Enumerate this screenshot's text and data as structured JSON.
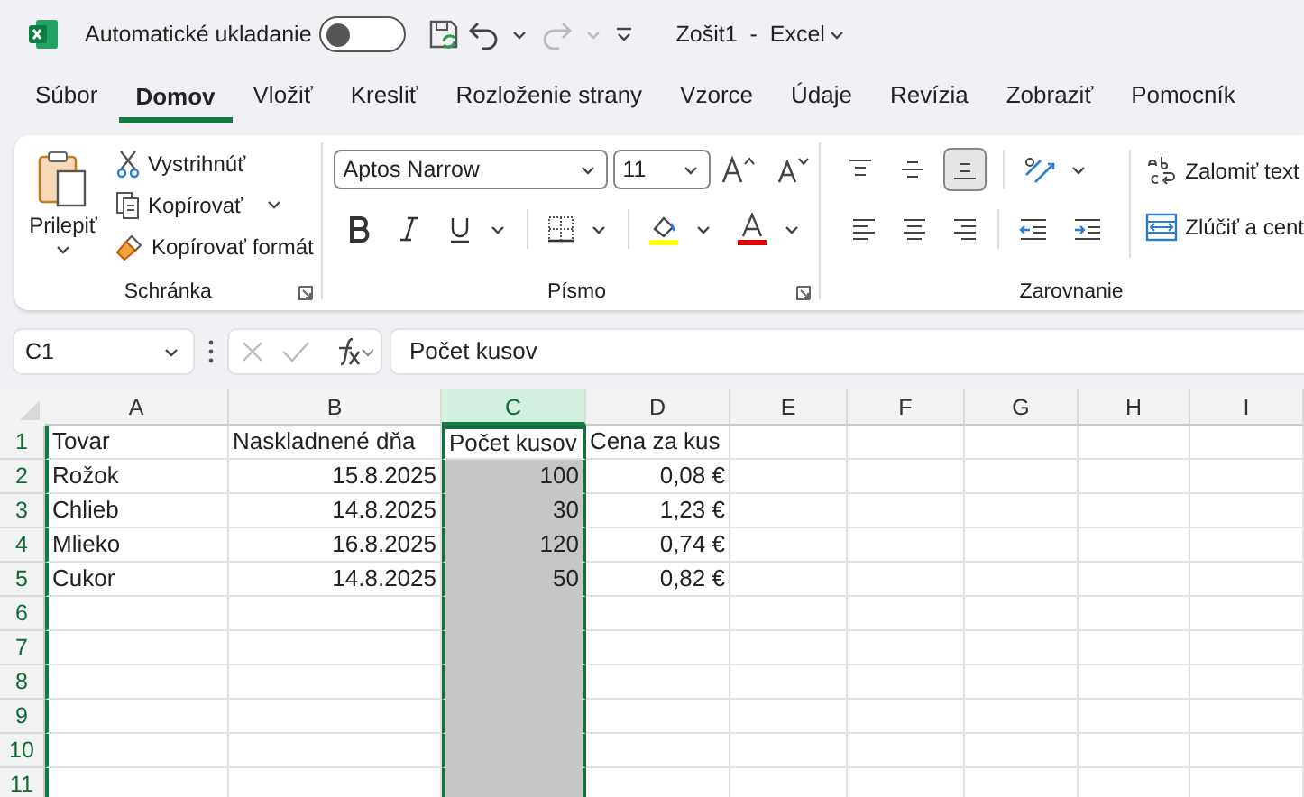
{
  "title_bar": {
    "autosave_label": "Automatické ukladanie",
    "autosave_on": false,
    "document_title": "Zošit1  -  Excel"
  },
  "tabs": [
    {
      "label": "Súbor",
      "selected": false
    },
    {
      "label": "Domov",
      "selected": true
    },
    {
      "label": "Vložiť",
      "selected": false
    },
    {
      "label": "Kresliť",
      "selected": false
    },
    {
      "label": "Rozloženie strany",
      "selected": false
    },
    {
      "label": "Vzorce",
      "selected": false
    },
    {
      "label": "Údaje",
      "selected": false
    },
    {
      "label": "Revízia",
      "selected": false
    },
    {
      "label": "Zobraziť",
      "selected": false
    },
    {
      "label": "Pomocník",
      "selected": false
    }
  ],
  "ribbon": {
    "clipboard": {
      "label": "Schránka",
      "paste": "Prilepiť",
      "cut": "Vystrihnúť",
      "copy": "Kopírovať",
      "format_painter": "Kopírovať formát"
    },
    "font": {
      "label": "Písmo",
      "font_name": "Aptos Narrow",
      "font_size": "11"
    },
    "alignment": {
      "label": "Zarovnanie",
      "vertical": [
        {
          "kind": "top",
          "selected": false
        },
        {
          "kind": "middle",
          "selected": false
        },
        {
          "kind": "bottom",
          "selected": true
        }
      ],
      "wrap_text": "Zalomiť text",
      "merge": "Zlúčiť a cent"
    }
  },
  "formula_bar": {
    "name_box": "C1",
    "formula": "Počet kusov"
  },
  "sheet": {
    "columns": [
      {
        "label": "A",
        "selected": false
      },
      {
        "label": "B",
        "selected": false
      },
      {
        "label": "C",
        "selected": true
      },
      {
        "label": "D",
        "selected": false
      },
      {
        "label": "E",
        "selected": false
      },
      {
        "label": "F",
        "selected": false
      },
      {
        "label": "G",
        "selected": false
      },
      {
        "label": "H",
        "selected": false
      },
      {
        "label": "I",
        "selected": false
      }
    ],
    "rows": [
      {
        "number": "1",
        "active": true,
        "cells": [
          {
            "text": "Tovar",
            "kind": "text"
          },
          {
            "text": "Naskladnené dňa",
            "kind": "text"
          },
          {
            "text": "Počet kusov",
            "kind": "text"
          },
          {
            "text": "Cena za kus",
            "kind": "text"
          }
        ]
      },
      {
        "number": "2",
        "active": false,
        "cells": [
          {
            "text": "Rožok",
            "kind": "text"
          },
          {
            "text": "15.8.2025",
            "kind": "number"
          },
          {
            "text": "100",
            "kind": "number"
          },
          {
            "text": "0,08 €",
            "kind": "number"
          }
        ]
      },
      {
        "number": "3",
        "active": false,
        "cells": [
          {
            "text": "Chlieb",
            "kind": "text"
          },
          {
            "text": "14.8.2025",
            "kind": "number"
          },
          {
            "text": "30",
            "kind": "number"
          },
          {
            "text": "1,23 €",
            "kind": "number"
          }
        ]
      },
      {
        "number": "4",
        "active": false,
        "cells": [
          {
            "text": "Mlieko",
            "kind": "text"
          },
          {
            "text": "16.8.2025",
            "kind": "number"
          },
          {
            "text": "120",
            "kind": "number"
          },
          {
            "text": "0,74 €",
            "kind": "number"
          }
        ]
      },
      {
        "number": "5",
        "active": false,
        "cells": [
          {
            "text": "Cukor",
            "kind": "text"
          },
          {
            "text": "14.8.2025",
            "kind": "number"
          },
          {
            "text": "50",
            "kind": "number"
          },
          {
            "text": "0,82 €",
            "kind": "number"
          }
        ]
      },
      {
        "number": "6",
        "active": false
      },
      {
        "number": "7",
        "active": false
      },
      {
        "number": "8",
        "active": false
      },
      {
        "number": "9",
        "active": false
      },
      {
        "number": "10",
        "active": false
      },
      {
        "number": "11",
        "active": false
      }
    ]
  }
}
